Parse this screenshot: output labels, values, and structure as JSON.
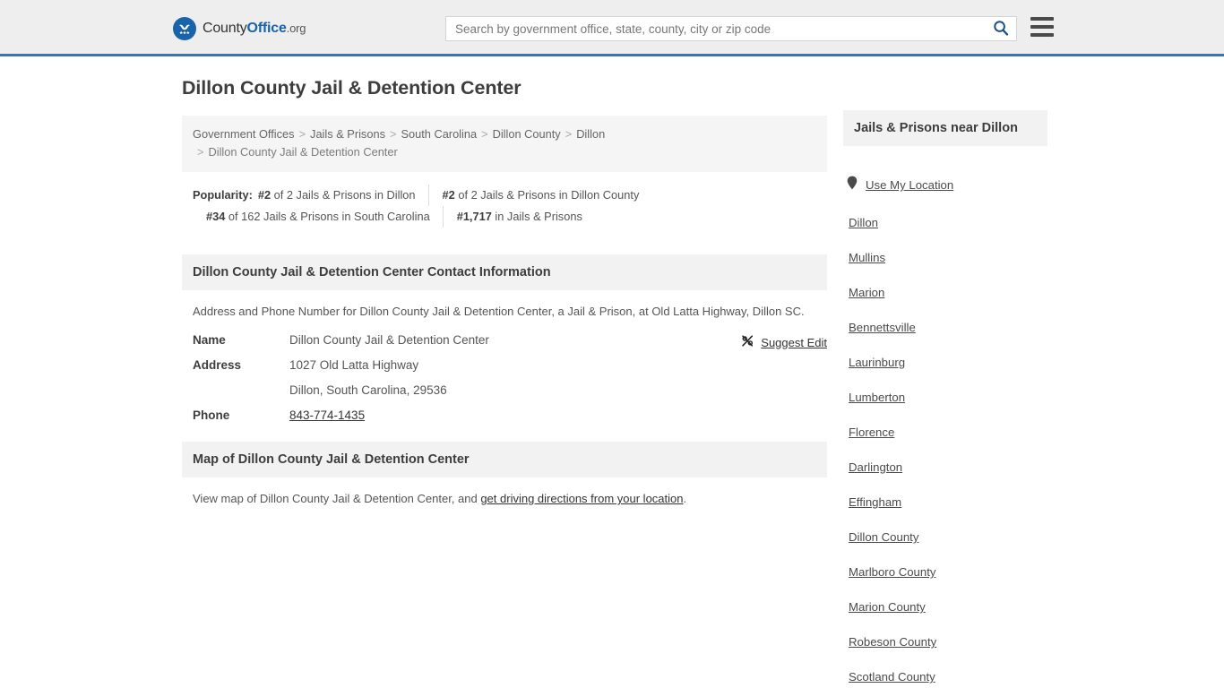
{
  "header": {
    "logo": {
      "part1": "County",
      "part2": "Office",
      "part3": ".org",
      "icon": "eagle-seal-icon"
    },
    "search": {
      "placeholder": "Search by government office, state, county, city or zip code",
      "value": "",
      "icon": "search-icon"
    },
    "menu_icon": "hamburger-menu-icon",
    "accent_color": "#3b75a9",
    "background": "#eeeeee"
  },
  "main": {
    "title": "Dillon County Jail & Detention Center",
    "breadcrumb": {
      "separator": ">",
      "items": [
        "Government Offices",
        "Jails & Prisons",
        "South Carolina",
        "Dillon County",
        "Dillon",
        "Dillon County Jail & Detention Center"
      ]
    },
    "popularity": {
      "label": "Popularity:",
      "entries": [
        {
          "rank": "#2",
          "text": "of 2 Jails & Prisons in Dillon"
        },
        {
          "rank": "#2",
          "text": "of 2 Jails & Prisons in Dillon County"
        },
        {
          "rank": "#34",
          "text": "of 162 Jails & Prisons in South Carolina"
        },
        {
          "rank": "#1,717",
          "text": "in Jails & Prisons"
        }
      ]
    },
    "contact_section": {
      "heading": "Dillon County Jail & Detention Center Contact Information",
      "description": "Address and Phone Number for Dillon County Jail & Detention Center, a Jail & Prison, at Old Latta Highway, Dillon SC.",
      "suggest_edit": {
        "label": "Suggest Edit",
        "icon": "edit-pencil-icon"
      },
      "rows": [
        {
          "key": "Name",
          "value": "Dillon County Jail & Detention Center",
          "is_link": false
        },
        {
          "key": "Address",
          "value": "1027 Old Latta Highway",
          "is_link": false
        },
        {
          "key": "",
          "value": "Dillon, South Carolina, 29536",
          "is_link": false
        },
        {
          "key": "Phone",
          "value": "843-774-1435",
          "is_link": true
        }
      ]
    },
    "map_section": {
      "heading": "Map of Dillon County Jail & Detention Center",
      "description_prefix": "View map of Dillon County Jail & Detention Center, and ",
      "description_link": "get driving directions from your location",
      "description_suffix": "."
    }
  },
  "sidebar": {
    "title": "Jails & Prisons near Dillon",
    "use_location": {
      "label": "Use My Location",
      "icon": "map-pin-icon"
    },
    "links": [
      "Dillon",
      "Mullins",
      "Marion",
      "Bennettsville",
      "Laurinburg",
      "Lumberton",
      "Florence",
      "Darlington",
      "Effingham",
      "Dillon County",
      "Marlboro County",
      "Marion County",
      "Robeson County",
      "Scotland County"
    ]
  }
}
